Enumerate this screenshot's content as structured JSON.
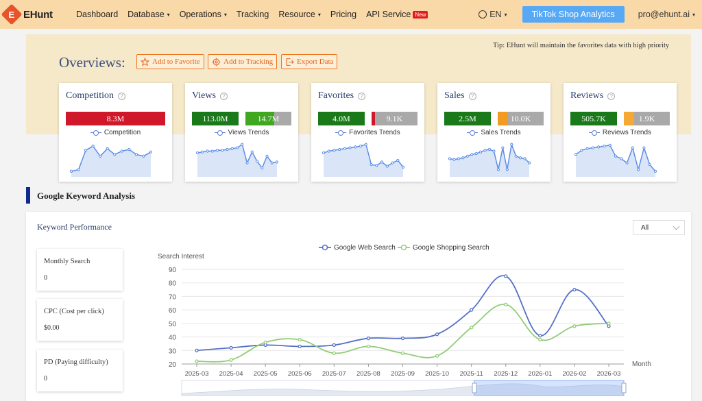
{
  "nav": {
    "logo_mark": "E",
    "logo_text": "EHunt",
    "items": [
      {
        "label": "Dashboard",
        "dropdown": false
      },
      {
        "label": "Database",
        "dropdown": true
      },
      {
        "label": "Operations",
        "dropdown": true
      },
      {
        "label": "Tracking",
        "dropdown": false
      },
      {
        "label": "Resource",
        "dropdown": true
      },
      {
        "label": "Pricing",
        "dropdown": false
      },
      {
        "label": "API Service",
        "dropdown": false
      }
    ],
    "new_badge": "New",
    "language": "EN",
    "tiktok_button": "TikTok Shop Analytics",
    "user_email": "pro@ehunt.ai",
    "caret": "▾"
  },
  "overview": {
    "title": "Overviews:",
    "buttons": {
      "favorite": "Add to Favorite",
      "tracking": "Add to Tracking",
      "export": "Export Data"
    },
    "tip": "Tip: EHunt will maintain the favorites data with high priority",
    "cards": [
      {
        "title": "Competition",
        "main_value": "8.3M",
        "main_color": "#d0182a",
        "secondary_value": "",
        "secondary_color": "",
        "legend": "Competition",
        "trend": [
          20,
          22,
          45,
          50,
          38,
          47,
          40,
          44,
          46,
          40,
          38,
          43
        ]
      },
      {
        "title": "Views",
        "main_value": "113.0M",
        "main_color": "#1a7a1a",
        "secondary_value": "14.7M",
        "secondary_color": "#3fa81f",
        "legend": "Views Trends",
        "trend": [
          42,
          43,
          44,
          44,
          45,
          45,
          46,
          47,
          48,
          52,
          30,
          43,
          32,
          24,
          38,
          30,
          31
        ]
      },
      {
        "title": "Favorites",
        "main_value": "4.0M",
        "main_color": "#1a7a1a",
        "secondary_value": "9.1K",
        "secondary_color": "#d0182a",
        "legend": "Favorites Trends",
        "trend": [
          42,
          44,
          45,
          46,
          47,
          48,
          49,
          50,
          52,
          28,
          27,
          31,
          26,
          30,
          33,
          25
        ]
      },
      {
        "title": "Sales",
        "main_value": "2.5M",
        "main_color": "#1a7a1a",
        "secondary_value": "10.0K",
        "secondary_color": "#f39a22",
        "legend": "Sales Trends",
        "trend": [
          35,
          34,
          35,
          36,
          38,
          40,
          41,
          43,
          45,
          46,
          44,
          22,
          48,
          22,
          52,
          38,
          36,
          35,
          30
        ]
      },
      {
        "title": "Reviews",
        "main_value": "505.7K",
        "main_color": "#1a7a1a",
        "secondary_value": "1.9K",
        "secondary_color": "#f5a833",
        "legend": "Reviews Trends",
        "trend": [
          40,
          45,
          47,
          48,
          49,
          50,
          51,
          38,
          35,
          30,
          48,
          22,
          48,
          28,
          20
        ]
      }
    ]
  },
  "keyword": {
    "section_title": "Google Keyword Analysis",
    "panel_title": "Keyword Performance",
    "filter_value": "All",
    "metrics": [
      {
        "label": "Monthly Search",
        "value": "0"
      },
      {
        "label": "CPC (Cost per click)",
        "value": "$0.00"
      },
      {
        "label": "PD (Paying difficulty)",
        "value": "0"
      }
    ]
  },
  "chart_data": {
    "type": "line",
    "ylabel": "Search Interest",
    "xlabel": "Month",
    "ylim": [
      20,
      90
    ],
    "yticks": [
      20,
      30,
      40,
      50,
      60,
      70,
      80,
      90
    ],
    "categories": [
      "2025-03",
      "2025-04",
      "2025-05",
      "2025-06",
      "2025-07",
      "2025-08",
      "2025-09",
      "2025-10",
      "2025-11",
      "2025-12",
      "2026-01",
      "2026-02",
      "2026-03"
    ],
    "series": [
      {
        "name": "Google Web Search",
        "color": "#5470c6",
        "values": [
          30,
          32,
          34,
          33,
          34,
          39,
          39,
          42,
          60,
          85,
          41,
          75,
          48
        ]
      },
      {
        "name": "Google Shopping Search",
        "color": "#91cc75",
        "values": [
          22,
          23,
          36,
          38,
          28,
          33,
          28,
          26,
          47,
          64,
          38,
          48,
          50
        ]
      }
    ],
    "legend_position": "top-center",
    "grid": true
  }
}
